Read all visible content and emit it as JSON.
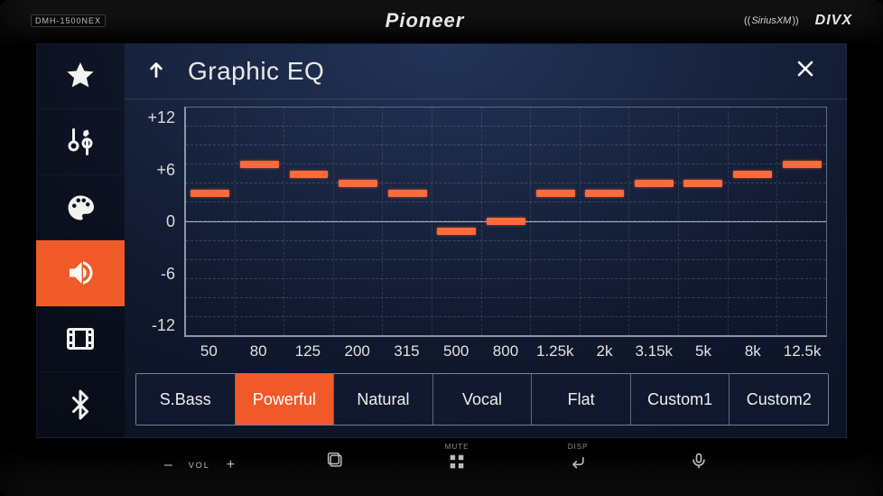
{
  "bezel": {
    "model": "DMH-1500NEX",
    "brand": "Pioneer",
    "sxm": "SiriusXM",
    "divx": "DIVX"
  },
  "header": {
    "title": "Graphic EQ"
  },
  "sidebar": {
    "items": [
      {
        "icon": "star",
        "active": false
      },
      {
        "icon": "tools",
        "active": false
      },
      {
        "icon": "palette",
        "active": false
      },
      {
        "icon": "speaker",
        "active": true
      },
      {
        "icon": "film",
        "active": false
      },
      {
        "icon": "bluetooth",
        "active": false
      }
    ]
  },
  "chart_data": {
    "type": "bar",
    "title": "Graphic EQ",
    "xlabel": "",
    "ylabel": "",
    "ylim": [
      -12,
      12
    ],
    "yticks": [
      -12,
      -6,
      0,
      6,
      12
    ],
    "ytick_labels": [
      "-12",
      "-6",
      "0",
      "+6",
      "+12"
    ],
    "categories": [
      "50",
      "80",
      "125",
      "200",
      "315",
      "500",
      "800",
      "1.25k",
      "2k",
      "3.15k",
      "5k",
      "8k",
      "12.5k"
    ],
    "values": [
      3,
      6,
      5,
      4,
      3,
      -1,
      0,
      3,
      3,
      4,
      4,
      5,
      6
    ]
  },
  "presets": {
    "items": [
      "S.Bass",
      "Powerful",
      "Natural",
      "Vocal",
      "Flat",
      "Custom1",
      "Custom2"
    ],
    "active_index": 1
  },
  "bottom": {
    "vol_label": "VOL",
    "mute_caption": "MUTE",
    "disp_caption": "DISP"
  }
}
